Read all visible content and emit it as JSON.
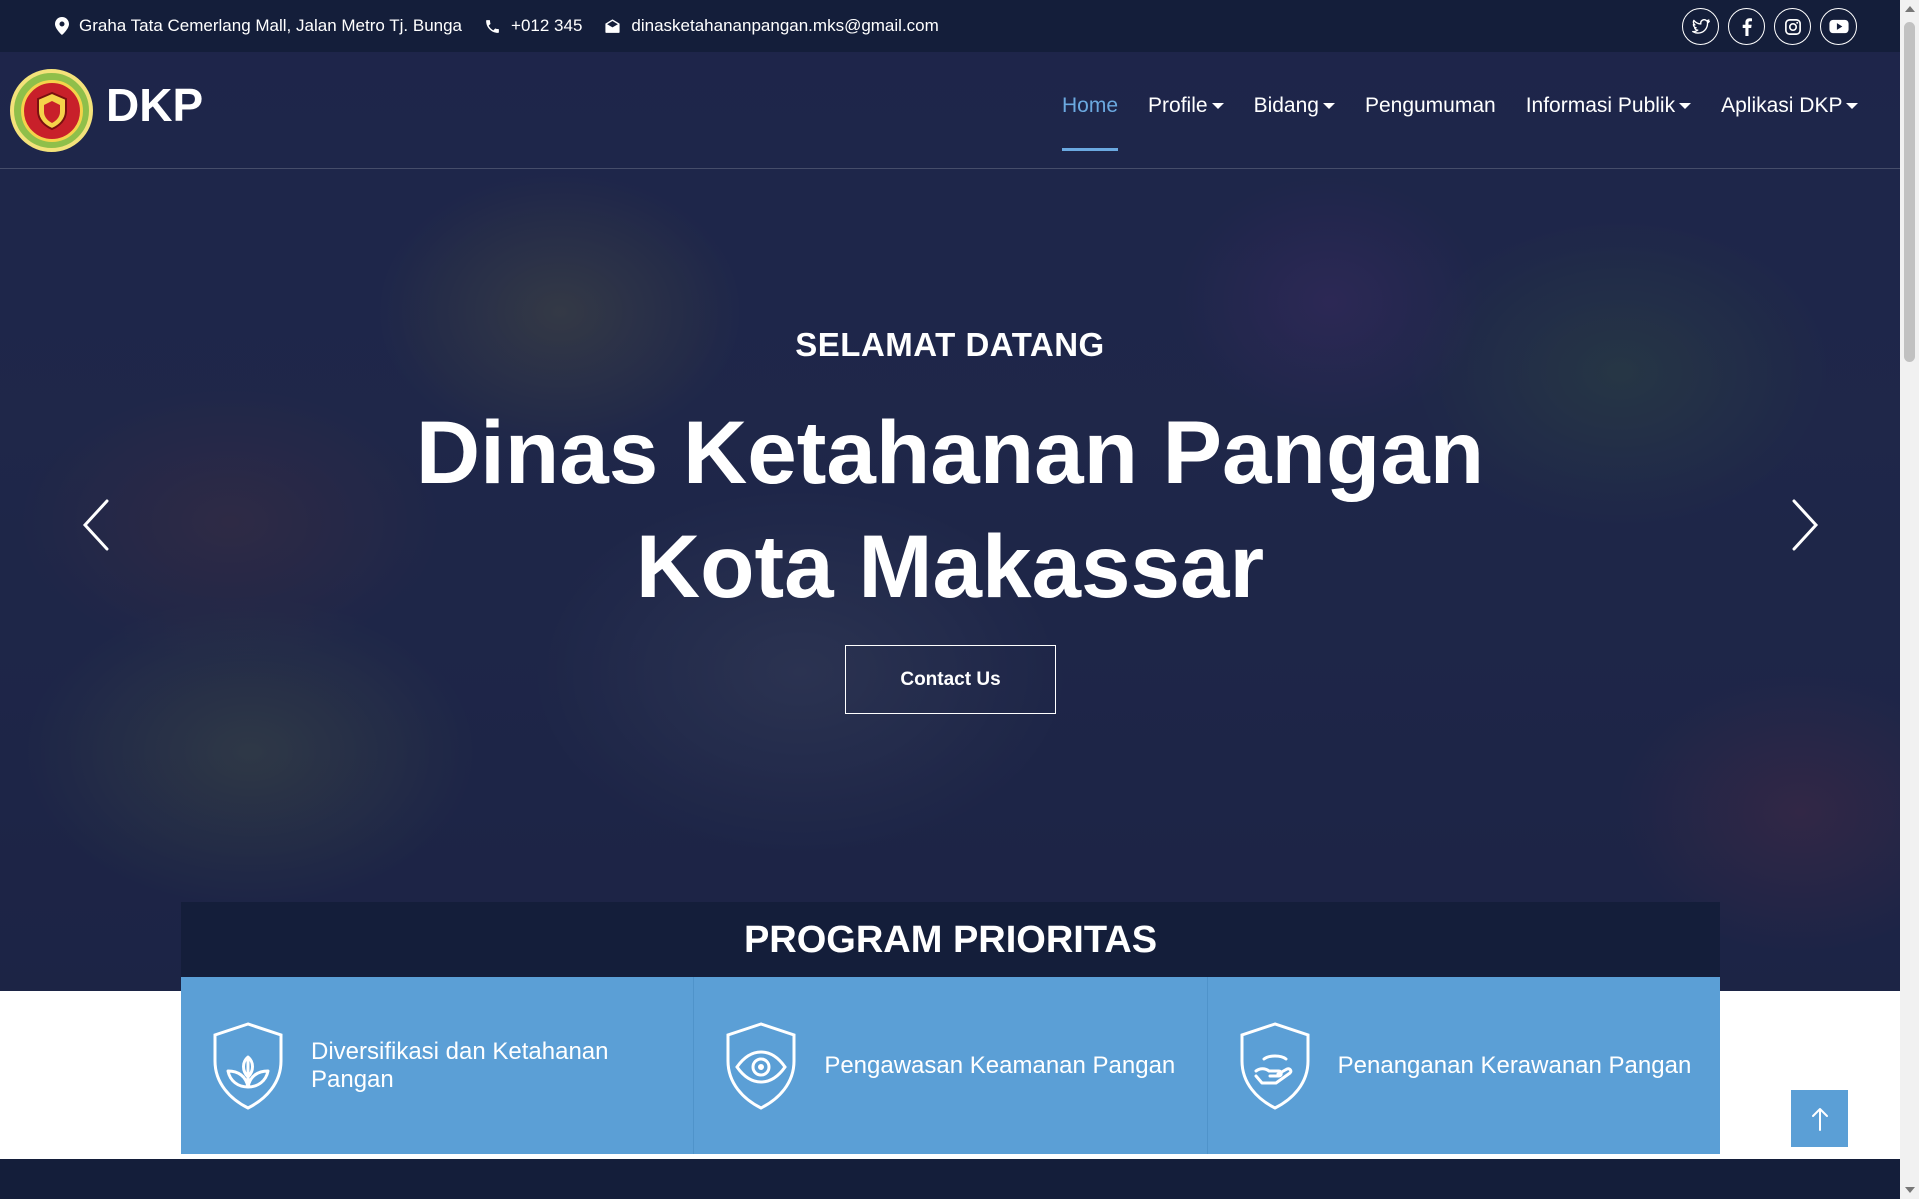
{
  "topbar": {
    "address": "Graha Tata Cemerlang Mall, Jalan Metro Tj. Bunga",
    "phone": "+012 345",
    "email": "dinasketahananpangan.mks@gmail.com",
    "socials": [
      "twitter-icon",
      "facebook-icon",
      "instagram-icon",
      "youtube-icon"
    ]
  },
  "brand": {
    "name": "DKP"
  },
  "nav": {
    "items": [
      {
        "label": "Home",
        "active": true,
        "dropdown": false
      },
      {
        "label": "Profile",
        "dropdown": true
      },
      {
        "label": "Bidang",
        "dropdown": true
      },
      {
        "label": "Pengumuman",
        "dropdown": false
      },
      {
        "label": "Informasi Publik",
        "dropdown": true
      },
      {
        "label": "Aplikasi DKP",
        "dropdown": true
      }
    ]
  },
  "hero": {
    "subtitle": "SELAMAT DATANG",
    "title_line1": "Dinas Ketahanan Pangan",
    "title_line2": "Kota Makassar",
    "cta": "Contact Us"
  },
  "program": {
    "heading": "PROGRAM PRIORITAS",
    "cards": [
      {
        "label": "Diversifikasi dan Ketahanan Pangan",
        "icon": "shield-leaf-icon"
      },
      {
        "label": "Pengawasan Keamanan Pangan",
        "icon": "shield-eye-icon"
      },
      {
        "label": "Penanganan Kerawanan Pangan",
        "icon": "shield-hand-icon"
      }
    ]
  },
  "colors": {
    "navy": "#141e3a",
    "accent": "#5b9fd6",
    "active_nav": "#6ba9e0"
  }
}
